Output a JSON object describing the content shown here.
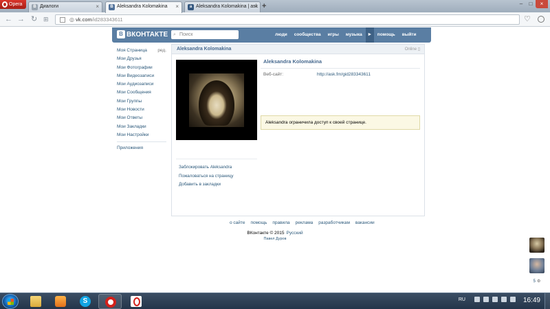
{
  "browser": {
    "menu_label": "Opera",
    "tabs": [
      {
        "title": "Диалоги",
        "icon": "vk-favicon"
      },
      {
        "title": "Aleksandra Kolomakina",
        "icon": "vk-favicon"
      },
      {
        "title": "Aleksandra Kolomakina | ask",
        "icon": "askfm-favicon"
      }
    ],
    "new_tab": "+",
    "url_host": "vk.com",
    "url_path": "/id283343611"
  },
  "vk": {
    "logo": "ВКОНТАКТЕ",
    "search_placeholder": "Поиск",
    "menu": [
      "люди",
      "сообщества",
      "игры",
      "музыка",
      "помощь",
      "выйти"
    ],
    "menu_arrow": "►",
    "sidebar": {
      "edit": "ред.",
      "items": [
        "Моя Страница",
        "Мои Друзья",
        "Мои Фотографии",
        "Мои Видеозаписи",
        "Мои Аудиозаписи",
        "Мои Сообщения",
        "Мои Группы",
        "Мои Новости",
        "Мои Ответы",
        "Мои Закладки",
        "Мои Настройки"
      ],
      "apps": "Приложения"
    },
    "profile": {
      "header_name": "Aleksandra Kolomakina",
      "status": "Online",
      "name": "Aleksandra Kolomakina",
      "website_label": "Веб-сайт:",
      "website_value": "http://ask.fm/gid283343611",
      "notice": "Aleksandra ограничила доступ к своей странице.",
      "actions": [
        "Заблокировать Aleksandra",
        "Пожаловаться на страницу",
        "Добавить в закладки"
      ]
    },
    "footer": {
      "links": [
        "о сайте",
        "помощь",
        "правила",
        "реклама",
        "разработчикам",
        "вакансии"
      ],
      "copyright": "ВКонтакте © 2015",
      "language": "Русский",
      "author": "Павел Дуров"
    },
    "side_widget_count": "5"
  },
  "taskbar": {
    "language": "RU",
    "time": "16:49"
  },
  "colors": {
    "vk_header": "#5a7ea3",
    "vk_link": "#2b587a",
    "notice_bg": "#fbf8e4",
    "taskbar": "#24354a"
  }
}
